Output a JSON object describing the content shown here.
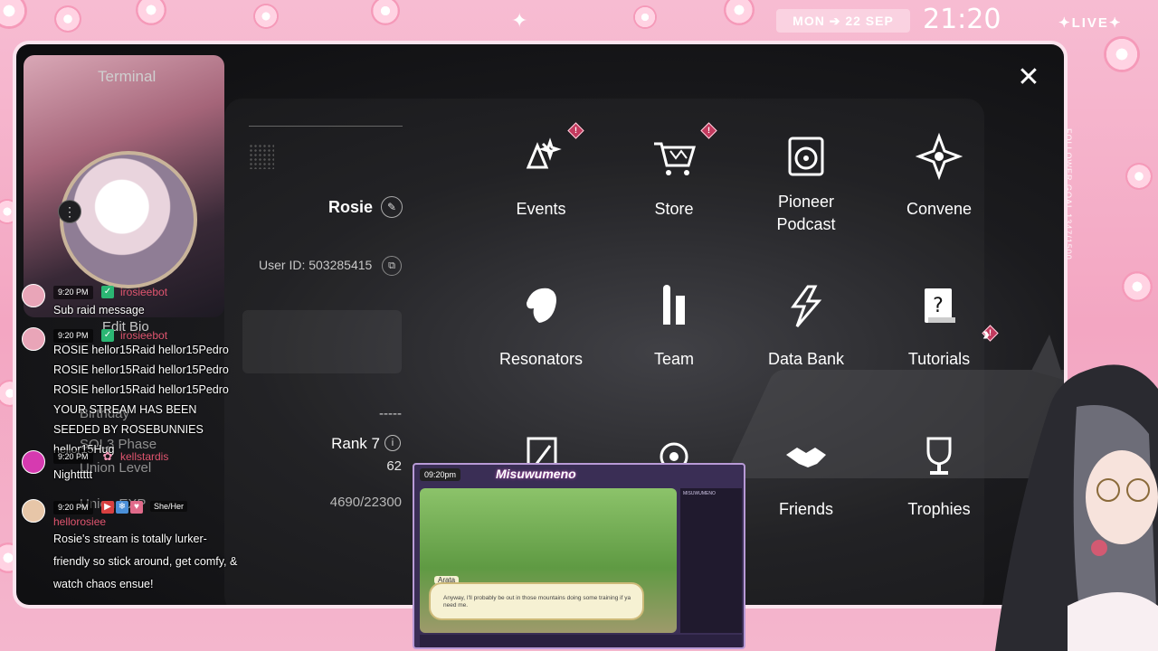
{
  "top_bar": {
    "date_label": "MON ➔ 22 SEP",
    "clock": "21:20",
    "live_label": "✦LIVE✦",
    "follower_goal": "FOLLOWER GOAL 1347/1500"
  },
  "game": {
    "window_title": "Terminal",
    "close_icon": "close-icon",
    "profile": {
      "username": "Rosie",
      "user_id": "User ID: 503285415",
      "bio_label": "Edit Bio",
      "birthday_label": "Birthday",
      "birthday_value": "-----",
      "phase_label": "SOL3 Phase",
      "phase_value": "Rank 7",
      "union_level_label": "Union Level",
      "union_level_value": "62",
      "union_exp_label": "Union EXP",
      "union_exp_value": "4690/22300"
    },
    "menu": [
      {
        "label": "Events",
        "icon": "events-icon",
        "alert": true
      },
      {
        "label": "Store",
        "icon": "cart-icon",
        "alert": true
      },
      {
        "label": "Pioneer\nPodcast",
        "icon": "podcast-icon",
        "alert": false
      },
      {
        "label": "Convene",
        "icon": "convene-icon",
        "alert": false
      },
      {
        "label": "Resonators",
        "icon": "resonator-icon",
        "alert": false
      },
      {
        "label": "Team",
        "icon": "team-icon",
        "alert": false
      },
      {
        "label": "Data Bank",
        "icon": "databank-icon",
        "alert": false
      },
      {
        "label": "Tutorials",
        "icon": "tutorials-icon",
        "alert": false
      },
      {
        "label": "",
        "icon": "mail-icon",
        "alert": false
      },
      {
        "label": "",
        "icon": "photo-icon",
        "alert": false
      },
      {
        "label": "Friends",
        "icon": "friends-icon",
        "alert": false
      },
      {
        "label": "Trophies",
        "icon": "trophy-icon",
        "alert": false
      }
    ],
    "alert_glyph": "!"
  },
  "chat": [
    {
      "time": "9:20 PM",
      "user": "irosieebot",
      "text": "Sub raid message"
    },
    {
      "time": "9:20 PM",
      "user": "irosieebot",
      "text": "ROSIE hellor15Raid hellor15Pedro ROSIE hellor15Raid hellor15Pedro ROSIE hellor15Raid hellor15Pedro YOUR STREAM HAS BEEN SEEDED BY ROSEBUNNIES hellor15Hug"
    },
    {
      "time": "9:20 PM",
      "user": "kellstardis",
      "text": "Nighttttt"
    },
    {
      "time": "9:20 PM",
      "user": "hellorosiee",
      "pronouns": "She/Her",
      "text": "Rosie's stream is totally lurker-friendly so stick around, get comfy, & watch chaos ensue!"
    }
  ],
  "embed": {
    "title": "Misuwumeno",
    "clock": "09:20pm",
    "speaker": "Arata",
    "dialogue": "Anyway, I'll probably be out in those mountains doing some training if ya need me.",
    "side_title": "MISUWUMENO"
  },
  "colors": {
    "accent_pink": "#f3a6c2",
    "alert_red": "#c23a5e",
    "chat_name": "#e0556f"
  }
}
